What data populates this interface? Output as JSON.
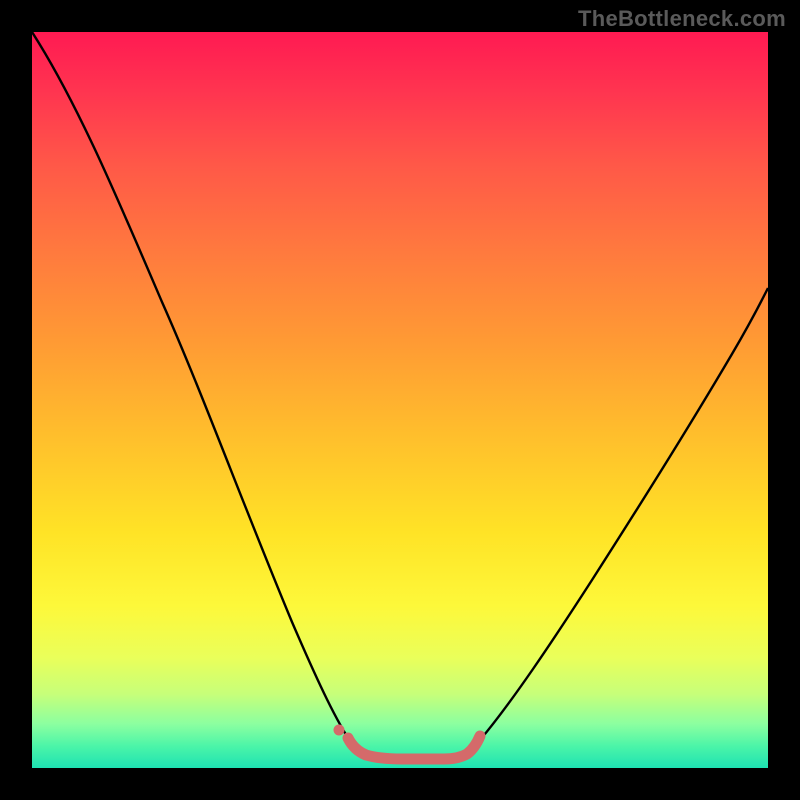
{
  "watermark": "TheBottleneck.com",
  "chart_data": {
    "type": "line",
    "title": "",
    "xlabel": "",
    "ylabel": "",
    "xlim": [
      0,
      100
    ],
    "ylim": [
      0,
      100
    ],
    "grid": false,
    "legend": false,
    "background": {
      "type": "vertical-gradient",
      "stops": [
        {
          "pos": 0,
          "color": "#ff1a52"
        },
        {
          "pos": 18,
          "color": "#ff5848"
        },
        {
          "pos": 42,
          "color": "#ff9a34"
        },
        {
          "pos": 68,
          "color": "#ffe326"
        },
        {
          "pos": 85,
          "color": "#eaff5a"
        },
        {
          "pos": 94,
          "color": "#8cffa0"
        },
        {
          "pos": 100,
          "color": "#1ee2b2"
        }
      ]
    },
    "series": [
      {
        "name": "bottleneck-curve",
        "color": "#000000",
        "stroke_width": 2.2,
        "x": [
          0,
          5,
          10,
          15,
          20,
          25,
          30,
          35,
          40,
          42,
          45,
          48,
          50,
          52,
          55,
          58,
          60,
          65,
          70,
          75,
          80,
          85,
          90,
          95,
          100
        ],
        "y": [
          100,
          94,
          85,
          74,
          62,
          50,
          38,
          26,
          14,
          10,
          5,
          2,
          1.5,
          1.5,
          1.5,
          1.8,
          3,
          9,
          17,
          26,
          35,
          44,
          52,
          60,
          68
        ]
      },
      {
        "name": "optimum-marker",
        "color": "#d46a6a",
        "stroke_width": 9,
        "linecap": "round",
        "x": [
          42.5,
          44,
          46,
          48,
          50,
          52,
          54,
          56,
          58,
          59.5
        ],
        "y": [
          3.5,
          2.0,
          1.4,
          1.2,
          1.2,
          1.2,
          1.2,
          1.4,
          2.0,
          3.8
        ]
      }
    ],
    "annotations": [
      {
        "name": "optimum-dot",
        "type": "point",
        "x": 42,
        "y": 4.2,
        "color": "#d46a6a",
        "radius": 5
      }
    ]
  }
}
